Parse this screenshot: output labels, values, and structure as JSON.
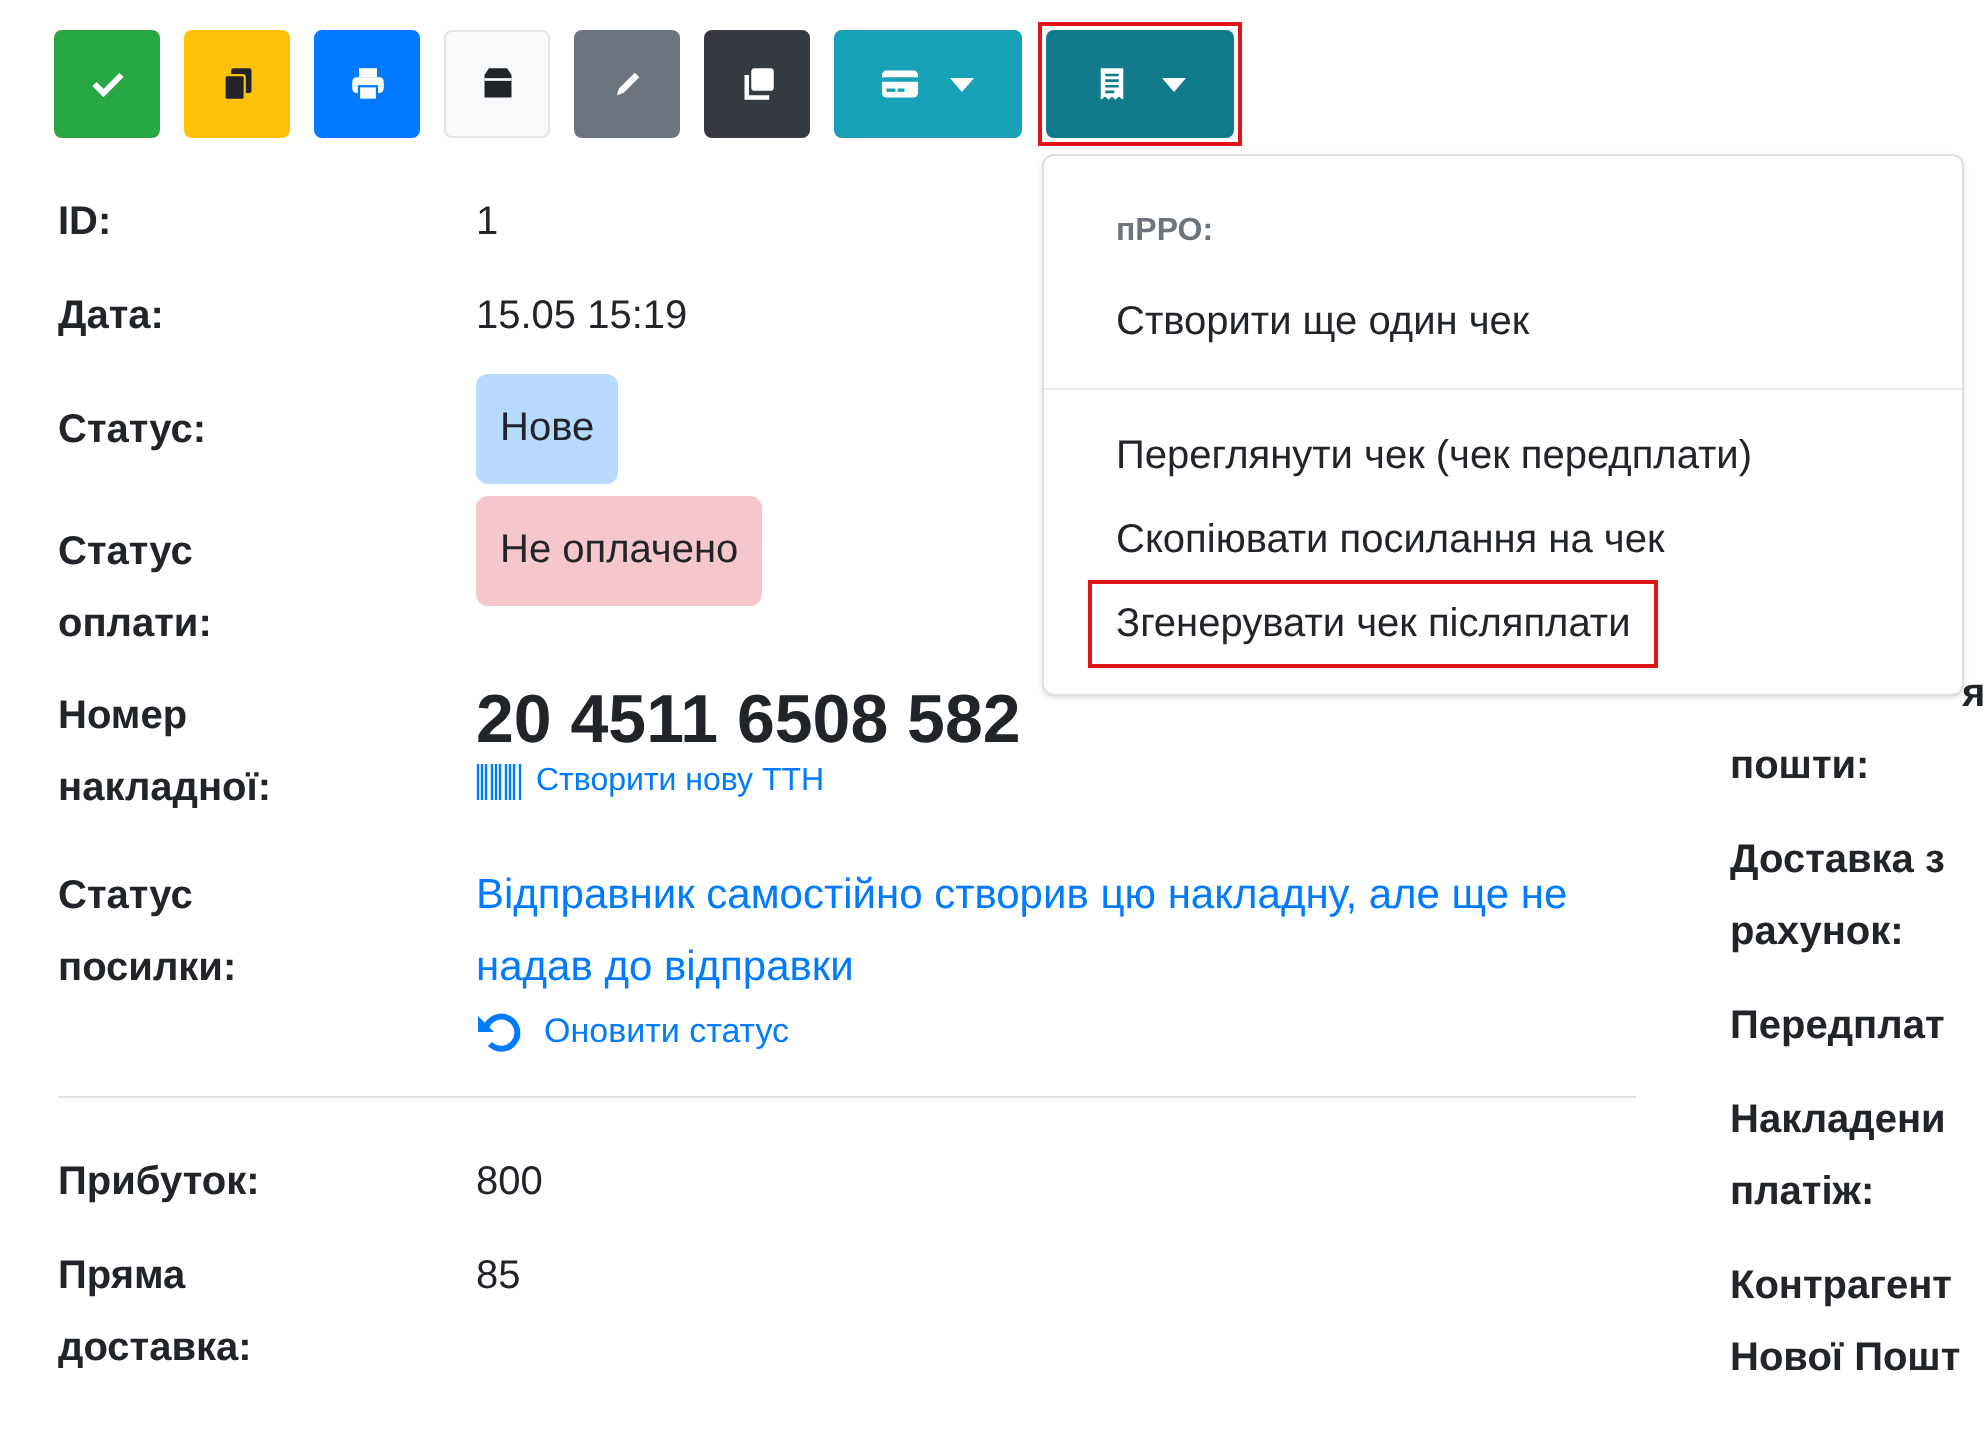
{
  "toolbar": [
    {
      "kind": "button",
      "annotated": false
    },
    {
      "kind": "button",
      "annotated": false
    },
    {
      "kind": "button",
      "annotated": false
    },
    {
      "kind": "button",
      "annotated": false
    },
    {
      "kind": "button",
      "annotated": false
    },
    {
      "kind": "button",
      "annotated": false
    },
    {
      "kind": "dropdown",
      "annotated": false
    },
    {
      "kind": "dropdown",
      "annotated": true
    }
  ],
  "menu": [
    {
      "kind": "header",
      "text": "пРРО:"
    },
    {
      "kind": "item",
      "text": "Створити ще один чек",
      "annotated": false
    },
    {
      "kind": "divider"
    },
    {
      "kind": "item",
      "text": "Переглянути чек (чек передплати)",
      "annotated": false
    },
    {
      "kind": "item",
      "text": "Скопіювати посилання на чек",
      "annotated": false
    },
    {
      "kind": "item",
      "text": "Згенерувати чек післяплати",
      "annotated": true
    }
  ],
  "details": [
    {
      "label": "ID:",
      "kind": "text",
      "value": "1"
    },
    {
      "label": "Дата:",
      "kind": "text",
      "value": "15.05 15:19"
    },
    {
      "label": "Статус:",
      "kind": "badge",
      "color": "#b8daff",
      "value": "Нове"
    },
    {
      "label": "Статус оплати:",
      "kind": "badge",
      "color": "#f5c6cb",
      "value": "Не оплачено"
    },
    {
      "label": "Номер накладної:",
      "kind": "tracking",
      "value": "20 4511 6508 582",
      "link": "Створити нову ТТН"
    },
    {
      "label": "Статус посилки:",
      "kind": "status",
      "value": "Відправник самостійно створив цю накладну, але ще не надав до відправки",
      "link": "Оновити статус"
    }
  ],
  "summary": [
    {
      "label": "Прибуток:",
      "value": "800"
    },
    {
      "label": "Пряма доставка:",
      "value": "85"
    }
  ],
  "right_labels": [
    [
      "я",
      "пошти:"
    ],
    [
      "Доставка з",
      "рахунок:"
    ],
    [
      "Передплат"
    ],
    [
      "Накладени",
      "платіж:"
    ],
    [
      "Контрагент",
      "Нової Пошт"
    ]
  ]
}
